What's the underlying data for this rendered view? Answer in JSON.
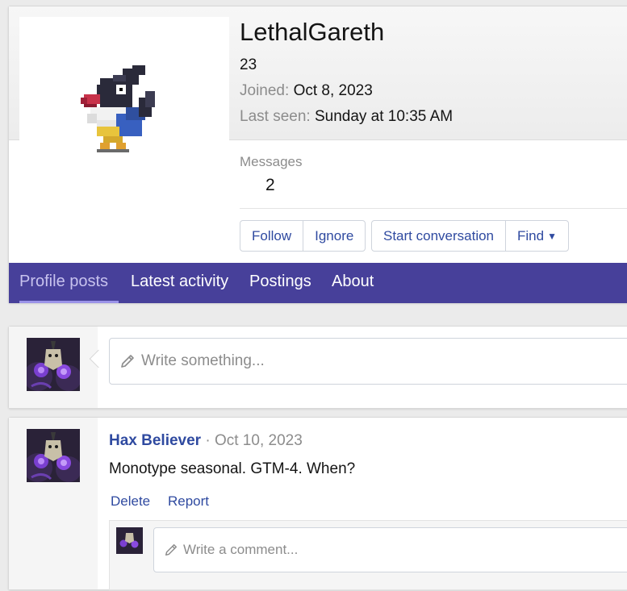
{
  "profile": {
    "username": "LethalGareth",
    "title": "23",
    "joined_label": "Joined:",
    "joined_value": "Oct 8, 2023",
    "last_seen_label": "Last seen:",
    "last_seen_value": "Sunday at 10:35 AM",
    "messages_label": "Messages",
    "messages_value": "2"
  },
  "actions": {
    "follow": "Follow",
    "ignore": "Ignore",
    "start_conversation": "Start conversation",
    "find": "Find"
  },
  "tabs": [
    {
      "label": "Profile posts",
      "active": true
    },
    {
      "label": "Latest activity",
      "active": false
    },
    {
      "label": "Postings",
      "active": false
    },
    {
      "label": "About",
      "active": false
    }
  ],
  "composer": {
    "placeholder": "Write something..."
  },
  "post": {
    "author": "Hax Believer",
    "separator": "·",
    "date": "Oct 10, 2023",
    "body": "Monotype seasonal. GTM-4. When?",
    "delete_label": "Delete",
    "report_label": "Report",
    "comment_placeholder": "Write a comment..."
  },
  "colors": {
    "tab_bar": "#47409a",
    "link": "#2f4aa0",
    "muted": "#8c8c8c"
  },
  "icons": {
    "avatar_sprite": "chatot-sprite",
    "pencil": "pencil-icon",
    "dropdown": "caret-down-icon"
  }
}
